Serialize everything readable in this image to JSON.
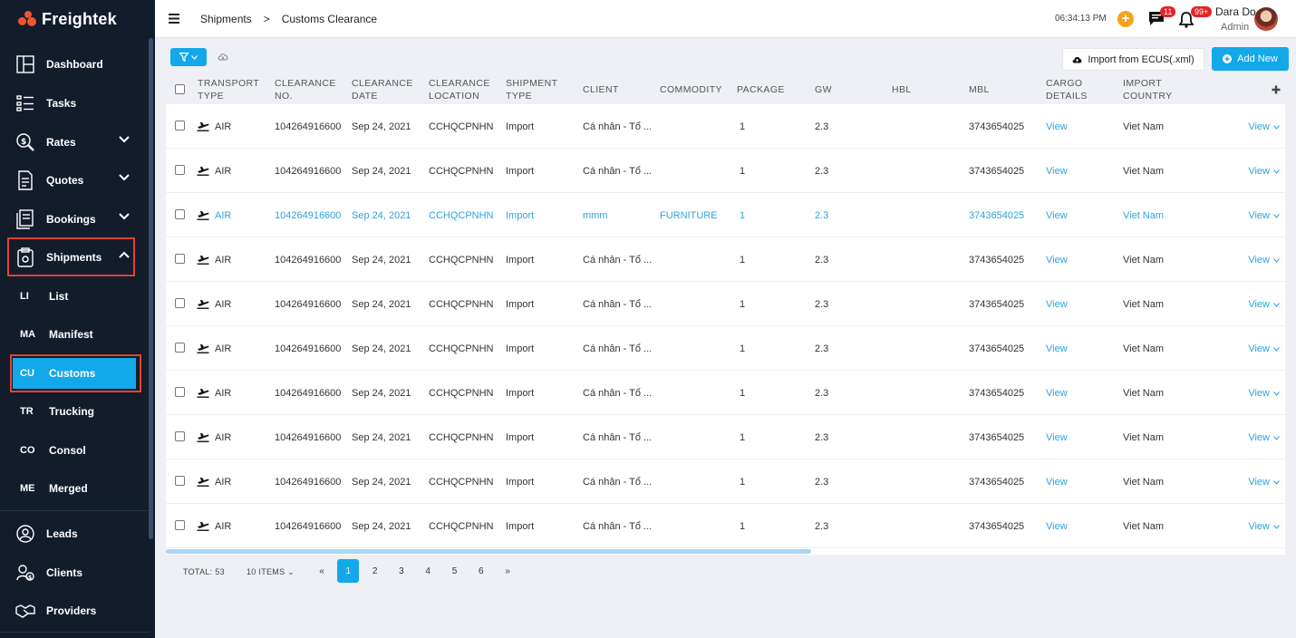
{
  "app": {
    "name": "Freightek"
  },
  "sidebar": {
    "items": [
      {
        "key": "dashboard",
        "label": "Dashboard",
        "icon": "dashboard-icon"
      },
      {
        "key": "tasks",
        "label": "Tasks",
        "icon": "tasks-icon"
      },
      {
        "key": "rates",
        "label": "Rates",
        "icon": "rates-icon",
        "expandable": true
      },
      {
        "key": "quotes",
        "label": "Quotes",
        "icon": "quotes-icon",
        "expandable": true
      },
      {
        "key": "bookings",
        "label": "Bookings",
        "icon": "bookings-icon",
        "expandable": true
      },
      {
        "key": "shipments",
        "label": "Shipments",
        "icon": "shipments-icon",
        "expanded": true
      }
    ],
    "sub_items": [
      {
        "abbr": "LI",
        "label": "List"
      },
      {
        "abbr": "MA",
        "label": "Manifest"
      },
      {
        "abbr": "CU",
        "label": "Customs",
        "active": true
      },
      {
        "abbr": "TR",
        "label": "Trucking"
      },
      {
        "abbr": "CO",
        "label": "Consol"
      },
      {
        "abbr": "ME",
        "label": "Merged"
      }
    ],
    "bottom_items": [
      {
        "label": "Leads",
        "icon": "leads-icon"
      },
      {
        "label": "Clients",
        "icon": "clients-icon"
      },
      {
        "label": "Providers",
        "icon": "providers-icon"
      }
    ]
  },
  "header": {
    "breadcrumb": [
      "Shipments",
      ">",
      "Customs Clearance"
    ],
    "time": "06:34:13 PM",
    "messages_badge": "11",
    "notifications_badge": "99+",
    "user_name": "Dara Do",
    "user_role": "Admin"
  },
  "toolbar": {
    "import_label": "Import from ECUS(.xml)",
    "add_new_label": "Add New"
  },
  "table": {
    "columns": [
      "TRANSPORT TYPE",
      "CLEARANCE NO.",
      "CLEARANCE DATE",
      "CLEARANCE LOCATION",
      "SHIPMENT TYPE",
      "CLIENT",
      "COMMODITY",
      "PACKAGE",
      "GW",
      "HBL",
      "MBL",
      "CARGO DETAILS",
      "IMPORT COUNTRY"
    ],
    "rows": [
      {
        "transport": "AIR",
        "clearance_no": "104264916600",
        "date": "Sep 24, 2021",
        "location": "CCHQCPNHN",
        "shipment_type": "Import",
        "client": "Cá nhân - Tổ ...",
        "commodity": "",
        "package": "1",
        "gw": "2.3",
        "hbl": "",
        "mbl": "3743654025",
        "cargo": "View",
        "country": "Viet Nam",
        "action": "View"
      },
      {
        "transport": "AIR",
        "clearance_no": "104264916600",
        "date": "Sep 24, 2021",
        "location": "CCHQCPNHN",
        "shipment_type": "Import",
        "client": "Cá nhân - Tổ ...",
        "commodity": "",
        "package": "1",
        "gw": "2.3",
        "hbl": "",
        "mbl": "3743654025",
        "cargo": "View",
        "country": "Viet Nam",
        "action": "View"
      },
      {
        "transport": "AIR",
        "clearance_no": "104264916600",
        "date": "Sep 24, 2021",
        "location": "CCHQCPNHN",
        "shipment_type": "Import",
        "client": "mmm",
        "commodity": "FURNITURE",
        "package": "1",
        "gw": "2.3",
        "hbl": "",
        "mbl": "3743654025",
        "cargo": "View",
        "country": "Viet Nam",
        "action": "View",
        "highlight": true
      },
      {
        "transport": "AIR",
        "clearance_no": "104264916600",
        "date": "Sep 24, 2021",
        "location": "CCHQCPNHN",
        "shipment_type": "Import",
        "client": "Cá nhân - Tổ ...",
        "commodity": "",
        "package": "1",
        "gw": "2.3",
        "hbl": "",
        "mbl": "3743654025",
        "cargo": "View",
        "country": "Viet Nam",
        "action": "View"
      },
      {
        "transport": "AIR",
        "clearance_no": "104264916600",
        "date": "Sep 24, 2021",
        "location": "CCHQCPNHN",
        "shipment_type": "Import",
        "client": "Cá nhân - Tổ ...",
        "commodity": "",
        "package": "1",
        "gw": "2.3",
        "hbl": "",
        "mbl": "3743654025",
        "cargo": "View",
        "country": "Viet Nam",
        "action": "View"
      },
      {
        "transport": "AIR",
        "clearance_no": "104264916600",
        "date": "Sep 24, 2021",
        "location": "CCHQCPNHN",
        "shipment_type": "Import",
        "client": "Cá nhân - Tổ ...",
        "commodity": "",
        "package": "1",
        "gw": "2.3",
        "hbl": "",
        "mbl": "3743654025",
        "cargo": "View",
        "country": "Viet Nam",
        "action": "View"
      },
      {
        "transport": "AIR",
        "clearance_no": "104264916600",
        "date": "Sep 24, 2021",
        "location": "CCHQCPNHN",
        "shipment_type": "Import",
        "client": "Cá nhân - Tổ ...",
        "commodity": "",
        "package": "1",
        "gw": "2.3",
        "hbl": "",
        "mbl": "3743654025",
        "cargo": "View",
        "country": "Viet Nam",
        "action": "View"
      },
      {
        "transport": "AIR",
        "clearance_no": "104264916600",
        "date": "Sep 24, 2021",
        "location": "CCHQCPNHN",
        "shipment_type": "Import",
        "client": "Cá nhân - Tổ ...",
        "commodity": "",
        "package": "1",
        "gw": "2.3",
        "hbl": "",
        "mbl": "3743654025",
        "cargo": "View",
        "country": "Viet Nam",
        "action": "View"
      },
      {
        "transport": "AIR",
        "clearance_no": "104264916600",
        "date": "Sep 24, 2021",
        "location": "CCHQCPNHN",
        "shipment_type": "Import",
        "client": "Cá nhân - Tổ ...",
        "commodity": "",
        "package": "1",
        "gw": "2.3",
        "hbl": "",
        "mbl": "3743654025",
        "cargo": "View",
        "country": "Viet Nam",
        "action": "View"
      },
      {
        "transport": "AIR",
        "clearance_no": "104264916600",
        "date": "Sep 24, 2021",
        "location": "CCHQCPNHN",
        "shipment_type": "Import",
        "client": "Cá nhân - Tổ ...",
        "commodity": "",
        "package": "1",
        "gw": "2.3",
        "hbl": "",
        "mbl": "3743654025",
        "cargo": "View",
        "country": "Viet Nam",
        "action": "View"
      }
    ]
  },
  "pagination": {
    "total_label": "TOTAL: 53",
    "items_label": "10 ITEMS",
    "prev": "«",
    "next": "»",
    "pages": [
      "1",
      "2",
      "3",
      "4",
      "5",
      "6"
    ],
    "current": "1"
  },
  "colors": {
    "accent": "#13a8e9",
    "sidebar_bg": "#131c2b",
    "brand": "#f0552b",
    "highlight_box": "#e0432f",
    "badge": "#e52424"
  }
}
